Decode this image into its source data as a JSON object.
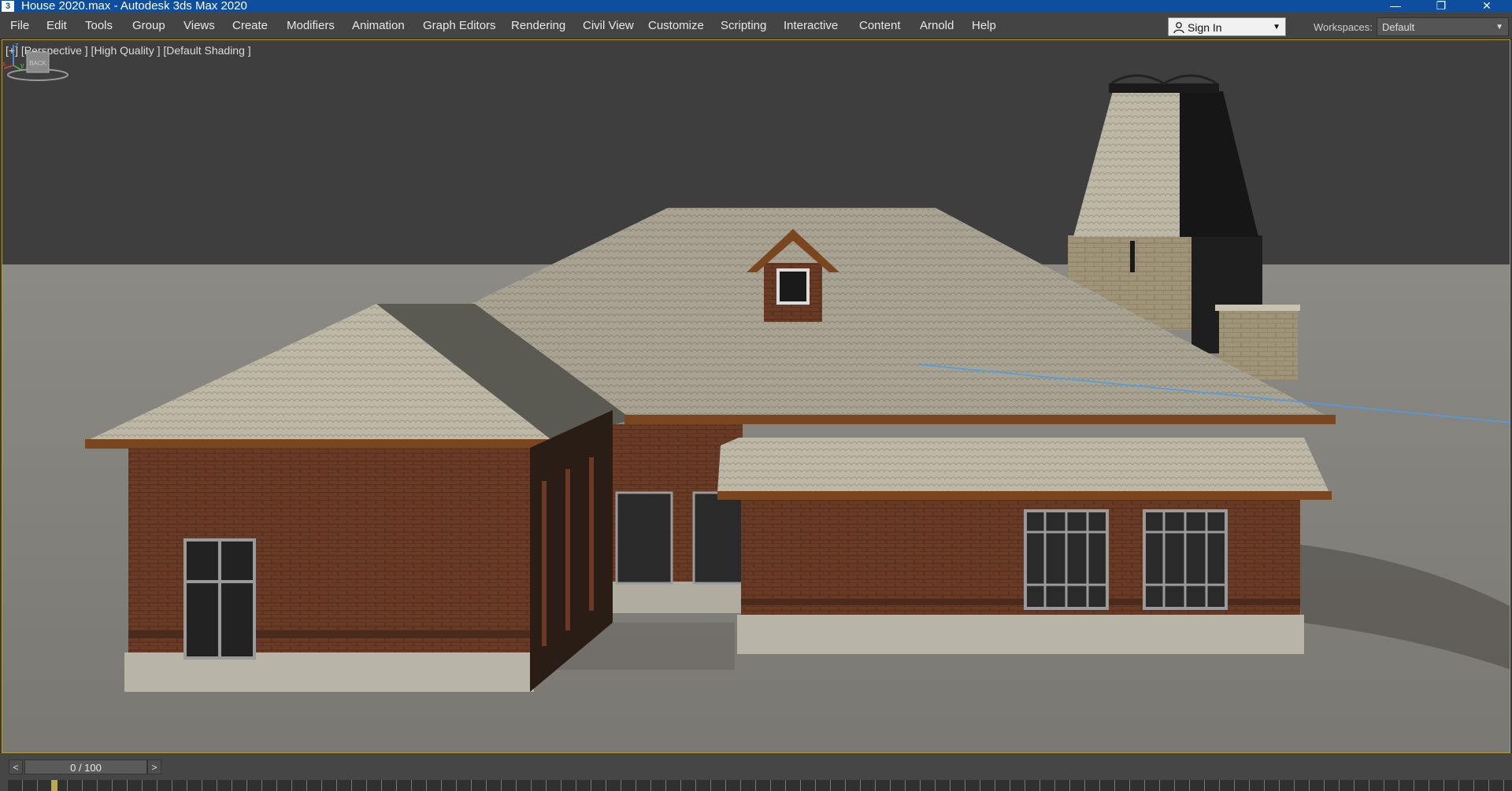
{
  "window": {
    "title": "House 2020.max - Autodesk 3ds Max 2020",
    "app_icon_glyph": "3",
    "controls": {
      "minimize": "—",
      "restore": "❐",
      "close": "✕"
    }
  },
  "menubar": {
    "items": [
      "File",
      "Edit",
      "Tools",
      "Group",
      "Views",
      "Create",
      "Modifiers",
      "Animation",
      "Graph Editors",
      "Rendering",
      "Civil View",
      "Customize",
      "Scripting",
      "Interactive",
      "Content",
      "Arnold",
      "Help"
    ]
  },
  "account": {
    "sign_in_label": "Sign In",
    "icon": "user-icon"
  },
  "workspaces": {
    "label": "Workspaces:",
    "value": "Default"
  },
  "viewport": {
    "label": "[+] [Perspective ] [High Quality ] [Default Shading ]",
    "viewcube_face": "BACK",
    "axes": {
      "x": "x",
      "y": "y",
      "z": "z"
    }
  },
  "timeline": {
    "prev_label": "<",
    "next_label": ">",
    "frame_display": "0 / 100"
  },
  "colors": {
    "titlebar": "#0d4f9e",
    "menubar": "#444444",
    "viewport_border": "#b49a3a",
    "brick": "#6e3b25",
    "roof": "#a59e8c"
  }
}
